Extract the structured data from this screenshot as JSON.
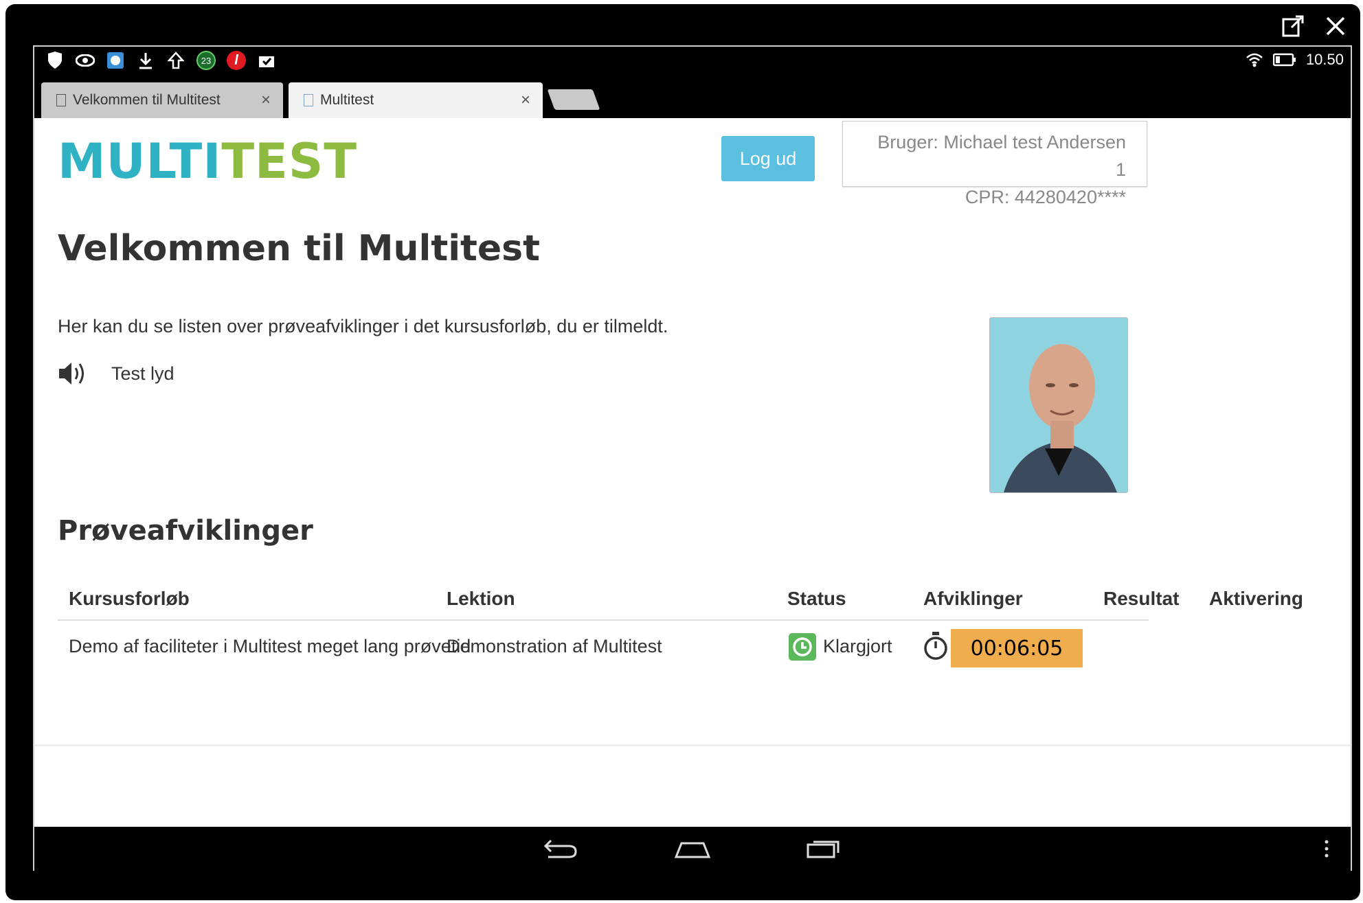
{
  "statusbar": {
    "clock": "10.50",
    "notif_badge": "23"
  },
  "tabs": [
    {
      "label": "Velkommen til Multitest",
      "close": "×"
    },
    {
      "label": "Multitest",
      "close": "×"
    }
  ],
  "header": {
    "logo_part1": "MULTI",
    "logo_part2": "TEST",
    "logout_label": "Log ud",
    "user_line": "Bruger: Michael test Andersen 1",
    "cpr_line": "CPR: 44280420****"
  },
  "main": {
    "title": "Velkommen til Multitest",
    "intro": "Her kan du se listen over prøveafviklinger i det kursusforløb, du er tilmeldt.",
    "sound_label": "Test lyd",
    "section_title": "Prøveafviklinger"
  },
  "table": {
    "columns": [
      "Kursusforløb",
      "Lektion",
      "Status",
      "Afviklinger",
      "Resultat",
      "Aktivering"
    ],
    "rows": [
      {
        "course": "Demo af faciliteter i Multitest meget lang prøvetid",
        "lesson": "Demonstration af Multitest",
        "status": "Klargjort",
        "timer": "00:06:05"
      }
    ]
  },
  "colors": {
    "accent": "#5bbfe0",
    "timer_bg": "#f0ad4e",
    "status_green": "#5cb85c",
    "logo_teal": "#2fb3c4",
    "logo_green": "#8cbb3f"
  }
}
